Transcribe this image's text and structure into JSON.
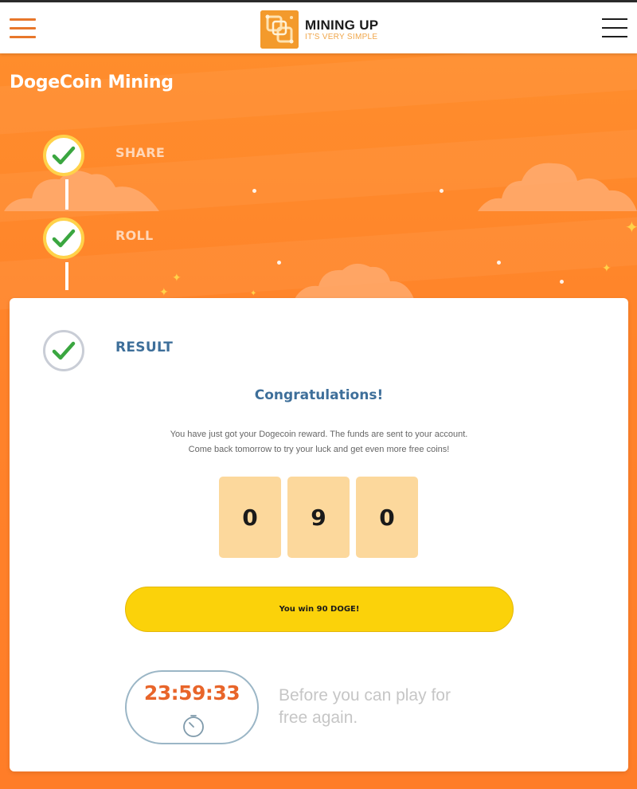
{
  "header": {
    "menu_icon": "hamburger-menu-icon",
    "logo": {
      "title": "MINING UP",
      "tagline": "IT'S VERY SIMPLE"
    },
    "nav_icon": "hamburger-menu-icon",
    "accent_color": "#e8772b"
  },
  "page": {
    "title": "DogeCoin Mining"
  },
  "steps": [
    {
      "label": "SHARE",
      "status": "done"
    },
    {
      "label": "ROLL",
      "status": "done"
    },
    {
      "label": "RESULT",
      "status": "done"
    }
  ],
  "result": {
    "heading": "Congratulations!",
    "description_line1": "You have just got your Dogecoin reward. The funds are sent to your account.",
    "description_line2": "Come back tomorrow to try your luck and get even more free coins!",
    "digits": [
      "0",
      "9",
      "0"
    ],
    "win_button_label": "You win 90 DOGE!"
  },
  "timer": {
    "value": "23:59:33",
    "icon": "stopwatch-icon",
    "note_line1": "Before you can play for",
    "note_line2": "free again."
  },
  "colors": {
    "background_orange": "#ff8a2a",
    "check_green": "#3aa640",
    "step_ring_yellow": "#ffd24a",
    "heading_blue": "#3e6f9a",
    "button_yellow": "#fbd20a",
    "digit_tile": "#fcd89c",
    "timer_orange": "#e8652a"
  }
}
